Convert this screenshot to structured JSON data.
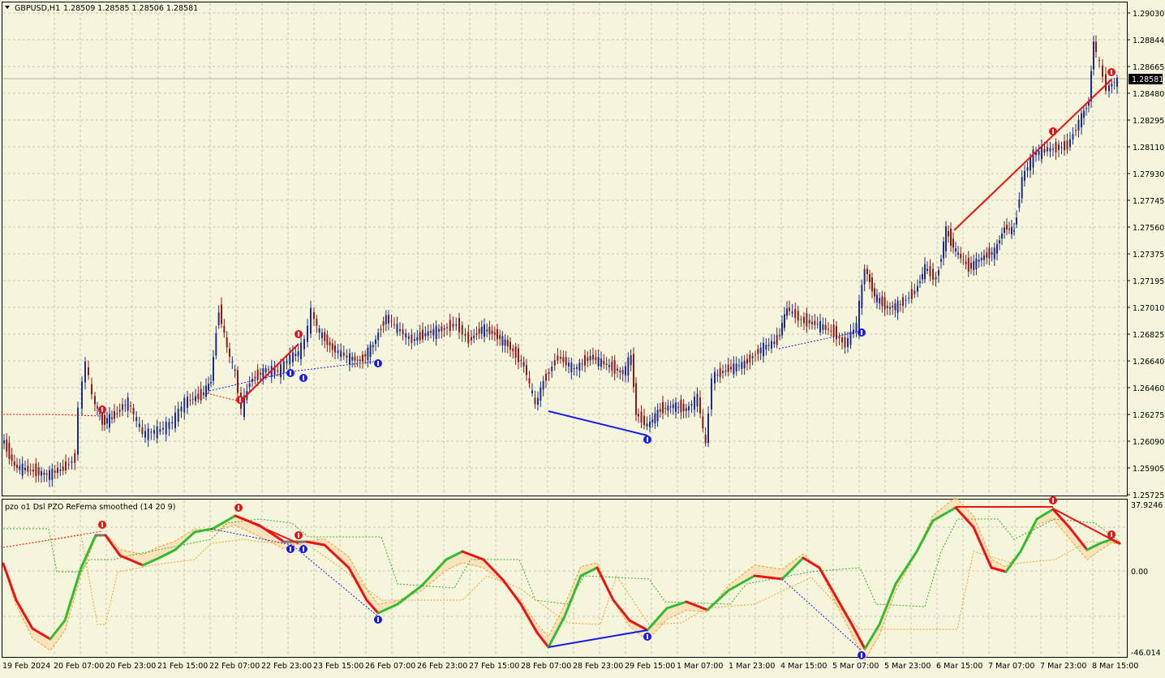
{
  "colors": {
    "background": "#f5f5dc",
    "grid": "#c8c8b4",
    "bull_candle": "#1e2b8c",
    "bear_candle": "#8b1a1a",
    "line_red": "#ee1111",
    "line_blue": "#1a1aee",
    "osc_green": "#33bb33",
    "osc_red": "#ee1111",
    "osc_gray": "#777777",
    "price_tag_bg": "#000000"
  },
  "main_chart": {
    "header": {
      "collapse_icon": "triangle-down-icon",
      "symbol": "GBPUSD,H1",
      "ohlc": "1.28509 1.28585 1.28506 1.28581"
    },
    "price_levels": [
      "1.29030",
      "1.28844",
      "1.28665",
      "1.28480",
      "1.28295",
      "1.28110",
      "1.27930",
      "1.27745",
      "1.27560",
      "1.27375",
      "1.27195",
      "1.27010",
      "1.26825",
      "1.26640",
      "1.26460",
      "1.26275",
      "1.26090",
      "1.25905",
      "1.25725"
    ],
    "current_price": "1.28581",
    "arrow_icons": {
      "up": "blue-up-arrow-icon",
      "down": "red-down-arrow-icon"
    }
  },
  "indicator": {
    "title": "pzo o1 Dsl PZO ReFema smoothed (14 20 9)",
    "levels": [
      "37.9246",
      "0.00",
      "-46.014"
    ]
  },
  "time_axis": [
    "19 Feb 2024",
    "20 Feb 07:00",
    "20 Feb 23:00",
    "21 Feb 15:00",
    "22 Feb 07:00",
    "22 Feb 23:00",
    "23 Feb 15:00",
    "26 Feb 07:00",
    "26 Feb 23:00",
    "27 Feb 15:00",
    "28 Feb 07:00",
    "28 Feb 23:00",
    "29 Feb 15:00",
    "1 Mar 07:00",
    "1 Mar 23:00",
    "4 Mar 15:00",
    "5 Mar 07:00",
    "5 Mar 23:00",
    "6 Mar 15:00",
    "7 Mar 07:00",
    "7 Mar 23:00",
    "8 Mar 15:00"
  ]
}
